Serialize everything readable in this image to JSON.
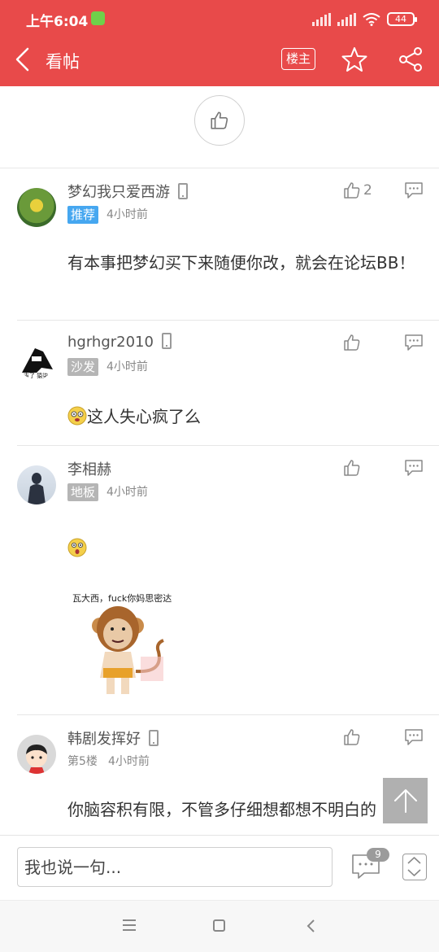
{
  "status_bar": {
    "time": "上午6:04",
    "battery": "44"
  },
  "header": {
    "title": "看帖",
    "owner_label": "楼主"
  },
  "posts": [
    {
      "username": "梦幻我只爱西游",
      "badge": "推荐",
      "time": "4小时前",
      "likes": "2",
      "content": "有本事把梦幻买下来随便你改，就会在论坛BB！"
    },
    {
      "username": "hgrhgr2010",
      "badge": "沙发",
      "time": "4小时前",
      "likes": "",
      "content": "这人失心疯了么"
    },
    {
      "username": "李相赫",
      "badge": "地板",
      "time": "4小时前",
      "likes": "",
      "content": "",
      "image_caption": "瓦大西，fuck你妈思密达"
    },
    {
      "username": "韩剧发挥好",
      "floor": "第5楼",
      "time": "4小时前",
      "likes": "",
      "content": "你脑容积有限，不管多仔细想都想不明白的"
    }
  ],
  "bottom_bar": {
    "placeholder": "我也说一句...",
    "comment_count": "9"
  },
  "colors": {
    "header_bg": "#e84a4a",
    "badge_blue": "#46a7f0",
    "badge_gray": "#b5b5b5"
  }
}
